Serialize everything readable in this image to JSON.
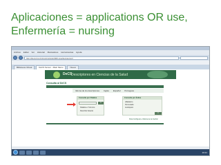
{
  "slide": {
    "title_line1": "Aplicaciones = applications OR use,",
    "title_line2": "Enfermería = nursing"
  },
  "browser": {
    "menu": [
      "Archivo",
      "Editar",
      "Ver",
      "Historial",
      "Marcadores",
      "Herramientas",
      "Ayuda"
    ],
    "address": "http://decs.bvs.br/cgi-bin/wxis1660.exe/decsserver/",
    "tabs": [
      "Biblioteca Virtual",
      "DeCS Server - Main Menu",
      "Nuevo"
    ],
    "active_tab_index": 1
  },
  "page": {
    "header_name": "DeCS",
    "header_subtitle": "Descriptores en Ciencias de la Salud",
    "consultar_label": "Consulta al DeCS",
    "languages_label": "Idioma de los descriptores",
    "languages": [
      "Inglés",
      "Español",
      "Portugués"
    ],
    "left_panel": {
      "header": "Consulta por Palabra",
      "go": "Ir",
      "options": [
        "Palabra o Término",
        "Descritor Exacto"
      ]
    },
    "right_panel": {
      "header": "Consulta por Índice",
      "options": [
        "Alfabético",
        "Permutado",
        "Jerárquico"
      ],
      "go": "Ir"
    },
    "footnote": "Para Configurar el Idioma de la Interfaz"
  },
  "taskbar": {
    "clock": "10:21"
  },
  "colors": {
    "title": "#3a8f33",
    "decs_green": "#2f6a47",
    "arrow": "#e53c33"
  }
}
